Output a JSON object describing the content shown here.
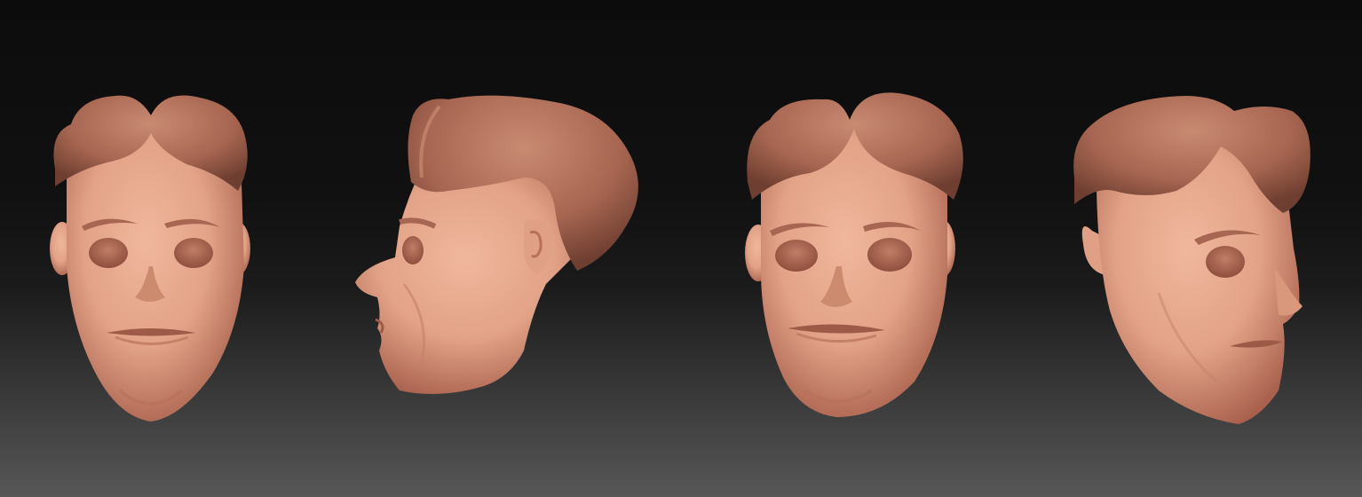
{
  "scene": {
    "background_top": "#0c0c0c",
    "background_bottom": "#575757",
    "skin_color": "#e2a287",
    "skin_shadow": "#b8705a",
    "hair_color": "#a76651",
    "hair_highlight": "#c98a72"
  },
  "views": [
    {
      "name": "front",
      "icon": "head-front"
    },
    {
      "name": "side-profile",
      "icon": "head-profile-left"
    },
    {
      "name": "front-three-quarter",
      "icon": "head-front"
    },
    {
      "name": "three-quarter-right",
      "icon": "head-three-quarter-right"
    }
  ]
}
